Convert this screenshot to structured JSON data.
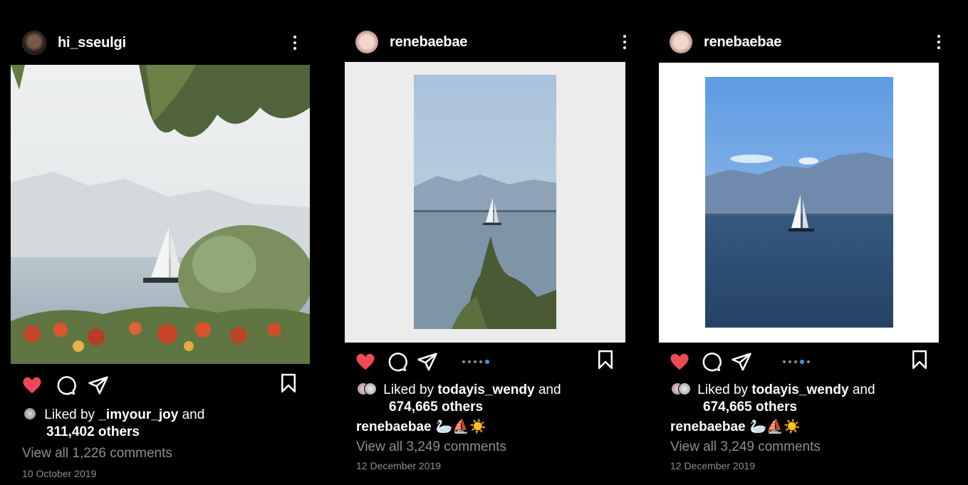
{
  "posts": [
    {
      "username": "hi_sseulgi",
      "liked_by_prefix": "Liked by",
      "liked_by_user": "_imyour_joy",
      "liked_by_and": "and",
      "others": "311,402 others",
      "view_comments": "View all 1,226 comments",
      "date": "10 October 2019"
    },
    {
      "username": "renebaebae",
      "liked_by_prefix": "Liked by",
      "liked_by_user": "todayis_wendy",
      "liked_by_and": "and",
      "others": "674,665 others",
      "caption_user": "renebaebae",
      "caption_emoji": "🦢⛵☀️",
      "view_comments": "View all 3,249 comments",
      "date": "12 December 2019",
      "carousel": {
        "count": 5,
        "active": 5
      }
    },
    {
      "username": "renebaebae",
      "liked_by_prefix": "Liked by",
      "liked_by_user": "todayis_wendy",
      "liked_by_and": "and",
      "others": "674,665 others",
      "caption_user": "renebaebae",
      "caption_emoji": "🦢⛵☀️",
      "view_comments": "View all 3,249 comments",
      "date": "12 December 2019",
      "carousel": {
        "count": 5,
        "active": 4
      }
    }
  ],
  "colors": {
    "like": "#ed4956",
    "dot_active": "#3897f0",
    "muted": "#8e8e8e"
  },
  "icons": [
    "more-icon",
    "heart-icon",
    "comment-icon",
    "share-icon",
    "bookmark-icon"
  ]
}
